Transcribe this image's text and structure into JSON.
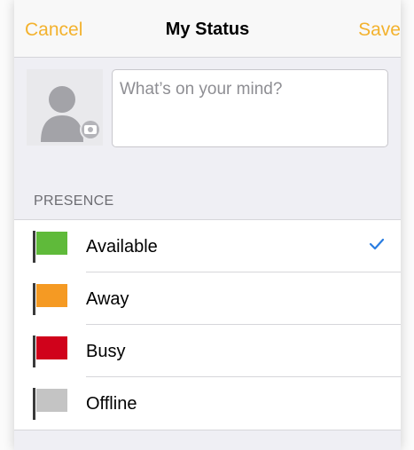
{
  "nav": {
    "cancel_label": "Cancel",
    "title": "My Status",
    "save_label": "Save"
  },
  "status": {
    "placeholder": "What’s on your mind?",
    "value": ""
  },
  "presence": {
    "header": "PRESENCE",
    "options": [
      {
        "label": "Available",
        "flag_color": "#5fba3a",
        "selected": true
      },
      {
        "label": "Away",
        "flag_color": "#f59a23",
        "selected": false
      },
      {
        "label": "Busy",
        "flag_color": "#d0021b",
        "selected": false
      },
      {
        "label": "Offline",
        "flag_color": "#c4c4c4",
        "selected": false
      }
    ]
  },
  "colors": {
    "accent": "#f3b22e",
    "checkmark": "#2a7de1",
    "background": "#efeff4"
  },
  "icons": {
    "avatar": "person-placeholder-icon",
    "camera": "camera-icon",
    "flag": "flag-icon",
    "check": "checkmark-icon"
  }
}
